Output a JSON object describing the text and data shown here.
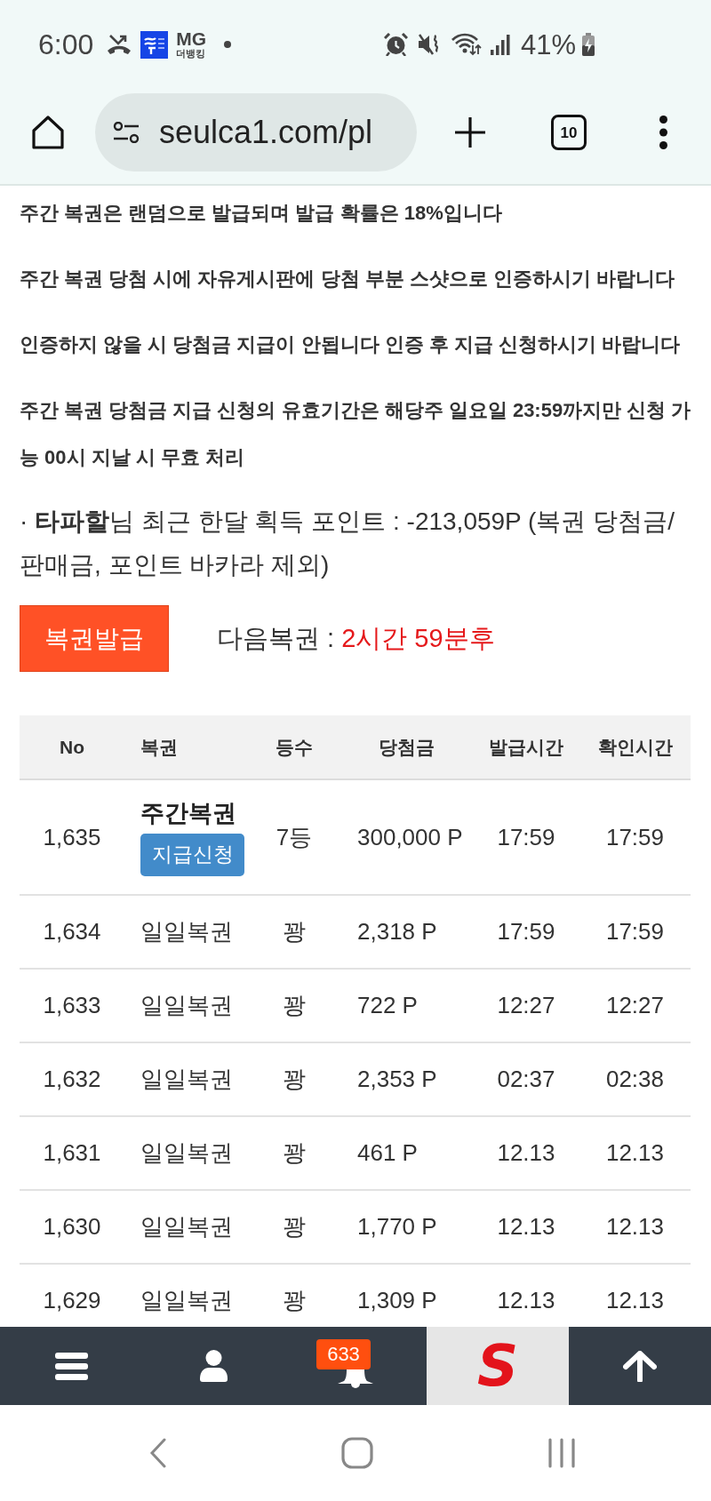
{
  "status_bar": {
    "time": "6:00",
    "notification_app": {
      "title": "MG",
      "subtitle": "더뱅킹"
    },
    "battery": "41%"
  },
  "browser_toolbar": {
    "url": "seulca1.com/pl",
    "tab_count": "10"
  },
  "notices": [
    "주간 복권은 랜덤으로 발급되며 발급 확률은 18%입니다",
    "주간 복권 당첨 시에 자유게시판에 당첨 부분 스샷으로 인증하시기 바랍니다",
    "인증하지 않을 시 당첨금 지급이 안됩니다 인증 후 지급 신청하시기 바랍니다",
    "주간 복권 당첨금 지급 신청의 유효기간은 해당주 일요일 23:59까지만 신청 가능 00시 지날 시 무효 처리"
  ],
  "points_summary": "· **타파할**님 최근 한달 획득 포인트 : -213,059P (복권 당첨금/판매금, 포인트 바카라 제외)",
  "issue_button": "복권발급",
  "next_ticket": {
    "label": "다음복권 :",
    "value": "2시간 59분후"
  },
  "table": {
    "columns": [
      "No",
      "복권",
      "등수",
      "당첨금",
      "발급시간",
      "확인시간"
    ],
    "rows": [
      {
        "kind": "weekly",
        "no": "1,635",
        "ticket": "주간복권",
        "claim_button": "지급신청",
        "rank": "7등",
        "prize": "300,000 P",
        "issued": "17:59",
        "checked": "17:59"
      },
      {
        "kind": "daily",
        "no": "1,634",
        "ticket": "일일복권",
        "rank": "꽝",
        "prize": "2,318 P",
        "issued": "17:59",
        "checked": "17:59"
      },
      {
        "kind": "daily",
        "no": "1,633",
        "ticket": "일일복권",
        "rank": "꽝",
        "prize": "722 P",
        "issued": "12:27",
        "checked": "12:27"
      },
      {
        "kind": "daily",
        "no": "1,632",
        "ticket": "일일복권",
        "rank": "꽝",
        "prize": "2,353 P",
        "issued": "02:37",
        "checked": "02:38"
      },
      {
        "kind": "daily",
        "no": "1,631",
        "ticket": "일일복권",
        "rank": "꽝",
        "prize": "461 P",
        "issued": "12.13",
        "checked": "12.13"
      },
      {
        "kind": "daily",
        "no": "1,630",
        "ticket": "일일복권",
        "rank": "꽝",
        "prize": "1,770 P",
        "issued": "12.13",
        "checked": "12.13"
      },
      {
        "kind": "daily",
        "no": "1,629",
        "ticket": "일일복권",
        "rank": "꽝",
        "prize": "1,309 P",
        "issued": "12.13",
        "checked": "12.13"
      }
    ]
  },
  "bottom_nav": {
    "items": [
      {
        "kind": "menu"
      },
      {
        "kind": "profile"
      },
      {
        "kind": "notifications",
        "badge": "633"
      },
      {
        "kind": "logo",
        "text": "S"
      },
      {
        "kind": "scroll_top"
      }
    ]
  }
}
